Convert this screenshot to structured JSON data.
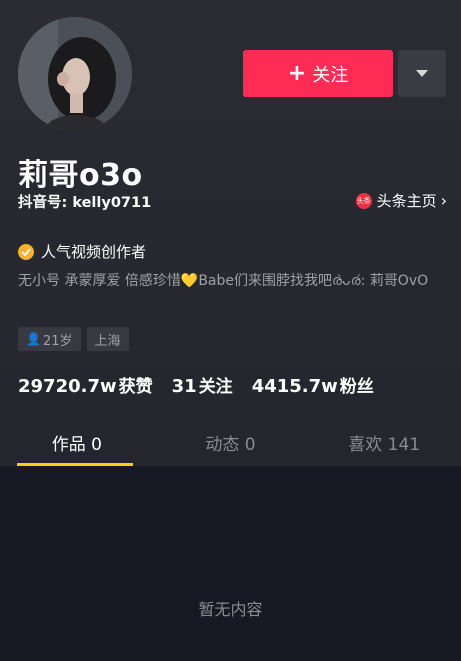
{
  "profile": {
    "nickname": "莉哥o3o",
    "douyin_id": "抖音号: kelly0711",
    "toutiao_link": "头条主页",
    "toutiao_icon_text": "头条",
    "verification": "人气视频创作者",
    "bio": "无小号 承蒙厚爱 倍感珍惜💛Babe们来围脖找我吧ര̀ᴗര́: 莉哥OvO",
    "tags": [
      "21岁",
      "上海"
    ]
  },
  "actions": {
    "follow_label": "关注",
    "follow_plus": "+"
  },
  "stats": [
    {
      "value": "29720.7w",
      "label": "获赞"
    },
    {
      "value": "31",
      "label": "关注"
    },
    {
      "value": "4415.7w",
      "label": "粉丝"
    }
  ],
  "tabs": [
    {
      "label": "作品 0",
      "active": true
    },
    {
      "label": "动态 0",
      "active": false
    },
    {
      "label": "喜欢 141",
      "active": false
    }
  ],
  "empty_text": "暂无内容",
  "colors": {
    "accent": "#fe2c55",
    "tab_indicator": "#face15",
    "background": "#161823"
  }
}
